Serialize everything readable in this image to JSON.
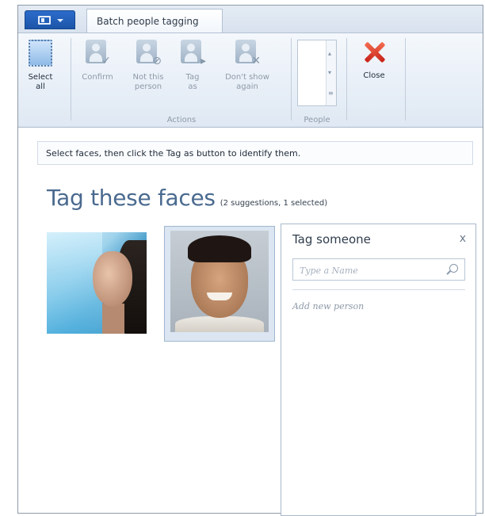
{
  "tab": {
    "label": "Batch people tagging"
  },
  "ribbon": {
    "select_all": "Select\nall",
    "actions": {
      "confirm": "Confirm",
      "not_this_person": "Not this\nperson",
      "tag_as": "Tag\nas",
      "dont_show_again": "Don't show\nagain",
      "group_label": "Actions"
    },
    "people_group_label": "People",
    "close": "Close"
  },
  "infobar": {
    "text": "Select faces, then click the Tag as button to identify them."
  },
  "main": {
    "heading": "Tag these faces",
    "subheading": "(2 suggestions, 1 selected)"
  },
  "tag_panel": {
    "title": "Tag someone",
    "close_glyph": "x",
    "name_placeholder": "Type a Name",
    "add_new": "Add new person"
  },
  "colors": {
    "accent": "#2c6ccb",
    "heading": "#4a6a8f",
    "close_red": "#d6301f"
  },
  "icons": {
    "file": "file-menu-icon",
    "select_all": "select-all-icon",
    "confirm": "person-confirm-icon",
    "not_this_person": "person-block-icon",
    "tag_as": "person-tag-icon",
    "dont_show_again": "person-hide-icon",
    "close": "close-x-icon",
    "search": "search-icon"
  }
}
